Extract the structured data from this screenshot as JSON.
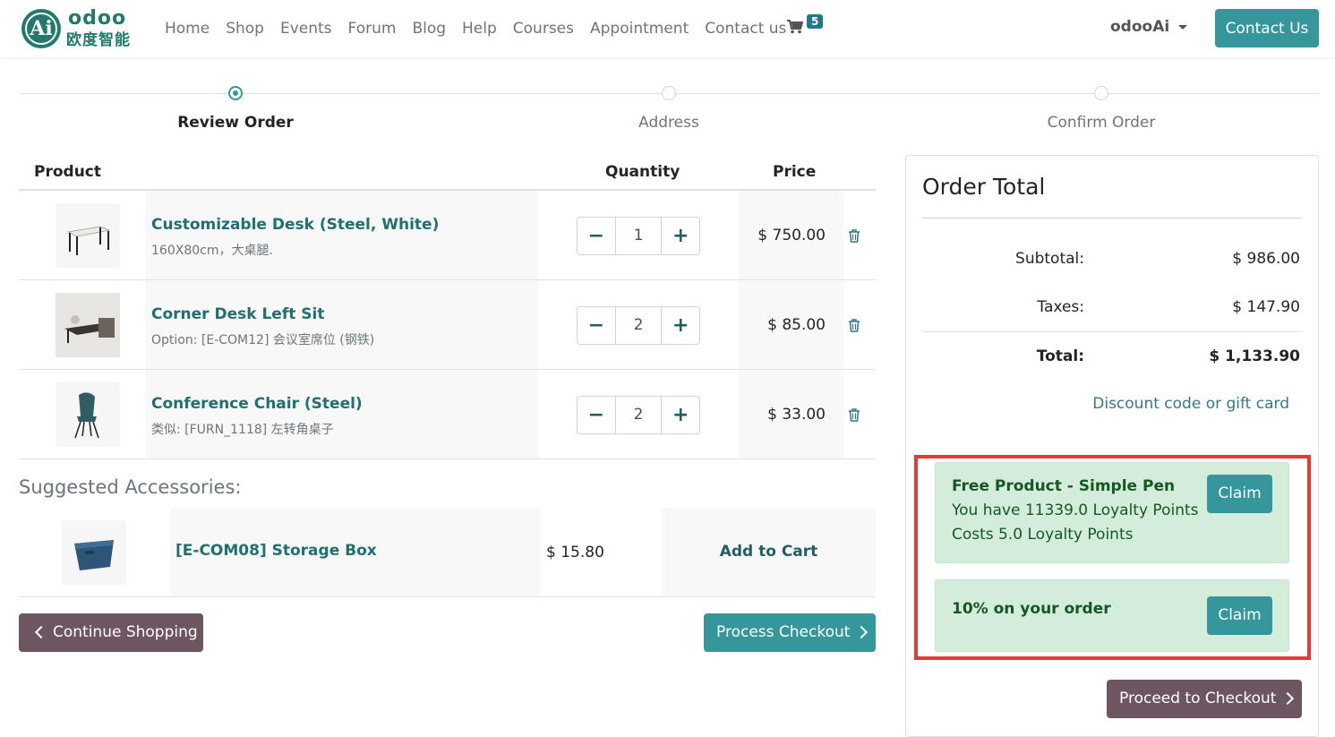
{
  "brand": {
    "name": "odoo",
    "subtitle_cn": "欧度智能",
    "mark": "Ai"
  },
  "nav": {
    "items": [
      "Home",
      "Shop",
      "Events",
      "Forum",
      "Blog",
      "Help",
      "Courses",
      "Appointment",
      "Contact us"
    ],
    "cart_count": "5",
    "user": "odooAi",
    "contact_button": "Contact Us"
  },
  "steps": [
    "Review Order",
    "Address",
    "Confirm Order"
  ],
  "table": {
    "headers": {
      "product": "Product",
      "quantity": "Quantity",
      "price": "Price"
    },
    "rows": [
      {
        "name": "Customizable Desk (Steel, White)",
        "desc": "160X80cm，大桌腿.",
        "qty": "1",
        "price": "$ 750.00"
      },
      {
        "name": "Corner Desk Left Sit",
        "desc": "Option: [E-COM12] 会议室席位 (钢铁)",
        "qty": "2",
        "price": "$ 85.00"
      },
      {
        "name": "Conference Chair (Steel)",
        "desc": "类似: [FURN_1118] 左转角桌子",
        "qty": "2",
        "price": "$ 33.00"
      }
    ]
  },
  "accessories": {
    "title": "Suggested Accessories:",
    "items": [
      {
        "name": "[E-COM08] Storage Box",
        "price": "$ 15.80",
        "action": "Add to Cart"
      }
    ]
  },
  "buttons": {
    "continue": "Continue Shopping",
    "process": "Process Checkout",
    "proceed": "Proceed to Checkout"
  },
  "order_total": {
    "title": "Order Total",
    "subtotal_label": "Subtotal:",
    "subtotal": "$ 986.00",
    "taxes_label": "Taxes:",
    "taxes": "$ 147.90",
    "total_label": "Total:",
    "total": "$ 1,133.90",
    "discount_link": "Discount code or gift card"
  },
  "rewards": [
    {
      "title": "Free Product - Simple Pen",
      "lines": [
        "You have 11339.0 Loyalty Points",
        "Costs 5.0 Loyalty Points"
      ],
      "button": "Claim"
    },
    {
      "title": "10% on your order",
      "lines": [],
      "button": "Claim"
    }
  ],
  "colors": {
    "primary": "#35979c",
    "secondary": "#6d5662",
    "success_bg": "#d4eddb",
    "highlight": "#e53935"
  }
}
